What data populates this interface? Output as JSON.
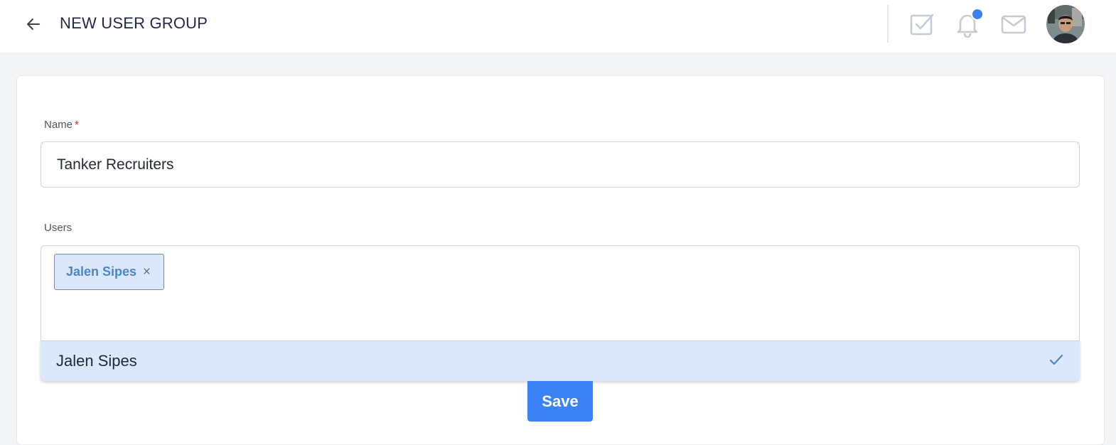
{
  "header": {
    "title": "NEW USER GROUP",
    "icons": [
      "arrow-left-icon",
      "task-checkbox-icon",
      "bell-icon",
      "mail-icon"
    ],
    "has_notification": true
  },
  "form": {
    "name": {
      "label": "Name",
      "required_mark": "*",
      "value": "Tanker Recruiters"
    },
    "users": {
      "label": "Users",
      "selected": [
        {
          "label": "Jalen Sipes",
          "remove": "×"
        }
      ],
      "options": [
        {
          "label": "Jalen Sipes",
          "selected": true
        }
      ]
    },
    "save_label": "Save"
  },
  "colors": {
    "accent": "#3b82f6",
    "chip_bg": "#dbe8fb",
    "chip_text": "#4a86c8",
    "required": "#dc2626"
  }
}
